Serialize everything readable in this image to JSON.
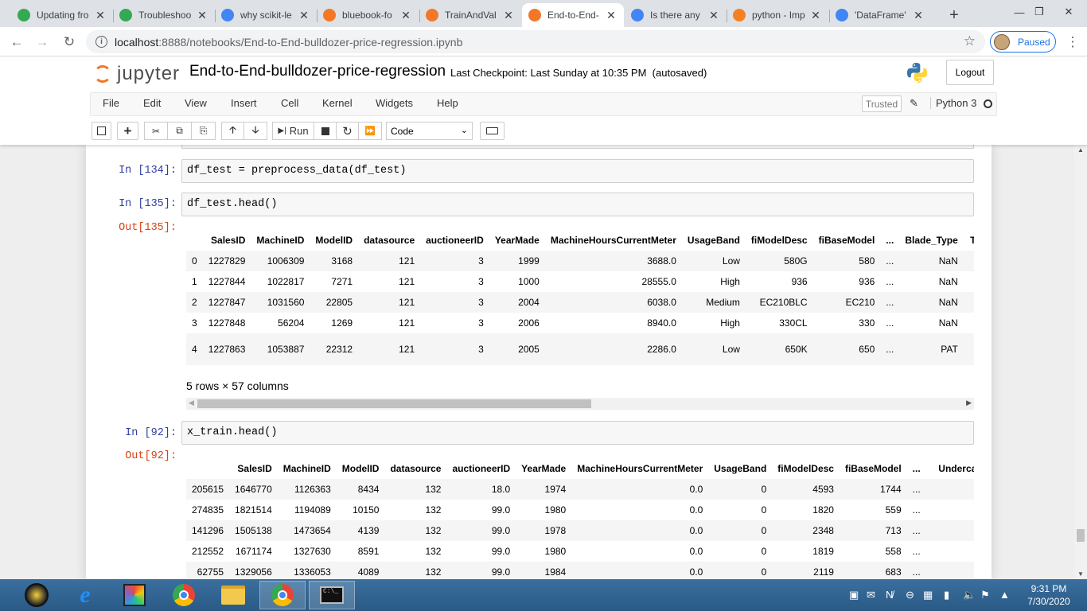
{
  "browser": {
    "tabs": [
      {
        "title": "Updating fro",
        "icon": "jupyter-green-icon",
        "color": "#34a853"
      },
      {
        "title": "Troubleshoo",
        "icon": "jupyter-green-icon",
        "color": "#34a853"
      },
      {
        "title": "why scikit-le",
        "icon": "google-icon",
        "color": "#4285f4"
      },
      {
        "title": "bluebook-fo",
        "icon": "kaggle-icon",
        "color": "#f37726"
      },
      {
        "title": "TrainAndVal",
        "icon": "jupyter-file-icon",
        "color": "#f37726"
      },
      {
        "title": "End-to-End-",
        "icon": "jupyter-notebook-icon",
        "color": "#f37726"
      },
      {
        "title": "Is there any",
        "icon": "google-icon",
        "color": "#4285f4"
      },
      {
        "title": "python - Imp",
        "icon": "stackoverflow-icon",
        "color": "#f48024"
      },
      {
        "title": "'DataFrame'",
        "icon": "google-icon",
        "color": "#4285f4"
      }
    ],
    "new_tab": "+",
    "address": {
      "host": "localhost",
      "path": ":8888/notebooks/End-to-End-bulldozer-price-regression.ipynb"
    },
    "profile_label": "Paused"
  },
  "jupyter": {
    "logo_text": "jupyter",
    "notebook_title": "End-to-End-bulldozer-price-regression",
    "checkpoint": "Last Checkpoint: Last Sunday at 10:35 PM  (autosaved)",
    "logout": "Logout",
    "menus": [
      "File",
      "Edit",
      "View",
      "Insert",
      "Cell",
      "Kernel",
      "Widgets",
      "Help"
    ],
    "trusted": "Trusted",
    "kernel": "Python 3",
    "run_label": "Run",
    "cell_type": "Code"
  },
  "cells": {
    "c134": {
      "prompt": "In [134]:",
      "code": "df_test = preprocess_data(df_test)"
    },
    "c135": {
      "prompt": "In [135]:",
      "code": "df_test.head()",
      "out_prompt": "Out[135]:"
    },
    "c92": {
      "prompt": "In [92]:",
      "code": "x_train.head()",
      "out_prompt": "Out[92]:"
    }
  },
  "df_test_table": {
    "columns": [
      "",
      "SalesID",
      "MachineID",
      "ModelID",
      "datasource",
      "auctioneerID",
      "YearMade",
      "MachineHoursCurrentMeter",
      "UsageBand",
      "fiModelDesc",
      "fiBaseModel",
      "...",
      "Blade_Type",
      "Trav"
    ],
    "rows": [
      [
        "0",
        "1227829",
        "1006309",
        "3168",
        "121",
        "3",
        "1999",
        "3688.0",
        "Low",
        "580G",
        "580",
        "...",
        "NaN",
        ""
      ],
      [
        "1",
        "1227844",
        "1022817",
        "7271",
        "121",
        "3",
        "1000",
        "28555.0",
        "High",
        "936",
        "936",
        "...",
        "NaN",
        ""
      ],
      [
        "2",
        "1227847",
        "1031560",
        "22805",
        "121",
        "3",
        "2004",
        "6038.0",
        "Medium",
        "EC210BLC",
        "EC210",
        "...",
        "NaN",
        ""
      ],
      [
        "3",
        "1227848",
        "56204",
        "1269",
        "121",
        "3",
        "2006",
        "8940.0",
        "High",
        "330CL",
        "330",
        "...",
        "NaN",
        ""
      ],
      [
        "4",
        "1227863",
        "1053887",
        "22312",
        "121",
        "3",
        "2005",
        "2286.0",
        "Low",
        "650K",
        "650",
        "...",
        "PAT",
        ""
      ]
    ],
    "shape": "5 rows × 57 columns"
  },
  "x_train_table": {
    "columns": [
      "",
      "SalesID",
      "MachineID",
      "ModelID",
      "datasource",
      "auctioneerID",
      "YearMade",
      "MachineHoursCurrentMeter",
      "UsageBand",
      "fiModelDesc",
      "fiBaseModel",
      "...",
      "Undercarria"
    ],
    "rows": [
      [
        "205615",
        "1646770",
        "1126363",
        "8434",
        "132",
        "18.0",
        "1974",
        "0.0",
        "0",
        "4593",
        "1744",
        "...",
        ""
      ],
      [
        "274835",
        "1821514",
        "1194089",
        "10150",
        "132",
        "99.0",
        "1980",
        "0.0",
        "0",
        "1820",
        "559",
        "...",
        ""
      ],
      [
        "141296",
        "1505138",
        "1473654",
        "4139",
        "132",
        "99.0",
        "1978",
        "0.0",
        "0",
        "2348",
        "713",
        "...",
        ""
      ],
      [
        "212552",
        "1671174",
        "1327630",
        "8591",
        "132",
        "99.0",
        "1980",
        "0.0",
        "0",
        "1819",
        "558",
        "...",
        ""
      ],
      [
        "62755",
        "1329056",
        "1336053",
        "4089",
        "132",
        "99.0",
        "1984",
        "0.0",
        "0",
        "2119",
        "683",
        "...",
        ""
      ]
    ]
  },
  "taskbar": {
    "clock_time": "9:31 PM",
    "clock_date": "7/30/2020"
  }
}
